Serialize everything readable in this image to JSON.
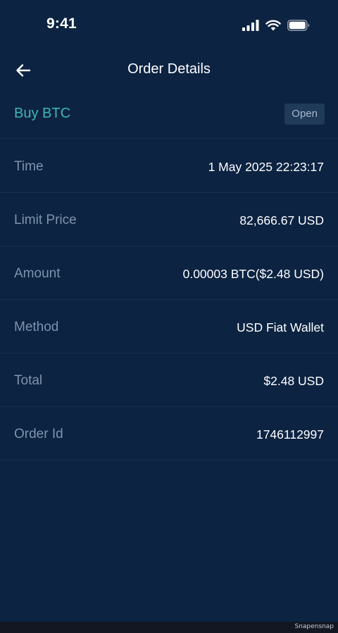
{
  "status_bar": {
    "time": "9:41",
    "icons": [
      "cellular-signal-icon",
      "wifi-icon",
      "battery-icon"
    ]
  },
  "header": {
    "back_icon": "arrow-left-icon",
    "title": "Order Details"
  },
  "order": {
    "type": "Buy BTC",
    "status": "Open",
    "details": [
      {
        "label": "Time",
        "value": "1 May 2025 22:23:17"
      },
      {
        "label": "Limit Price",
        "value": "82,666.67 USD"
      },
      {
        "label": "Amount",
        "value": "0.00003 BTC($2.48 USD)"
      },
      {
        "label": "Method",
        "value": "USD Fiat Wallet"
      },
      {
        "label": "Total",
        "value": "$2.48 USD"
      },
      {
        "label": "Order Id",
        "value": "1746112997"
      }
    ]
  },
  "footer": {
    "watermark": "Snapensnap"
  },
  "colors": {
    "background": "#0c2342",
    "accent": "#3fb6b0",
    "label": "#7f93ac",
    "badge_bg": "#203a5a",
    "badge_text": "#a8b7c9",
    "divider": "#1a3150"
  }
}
